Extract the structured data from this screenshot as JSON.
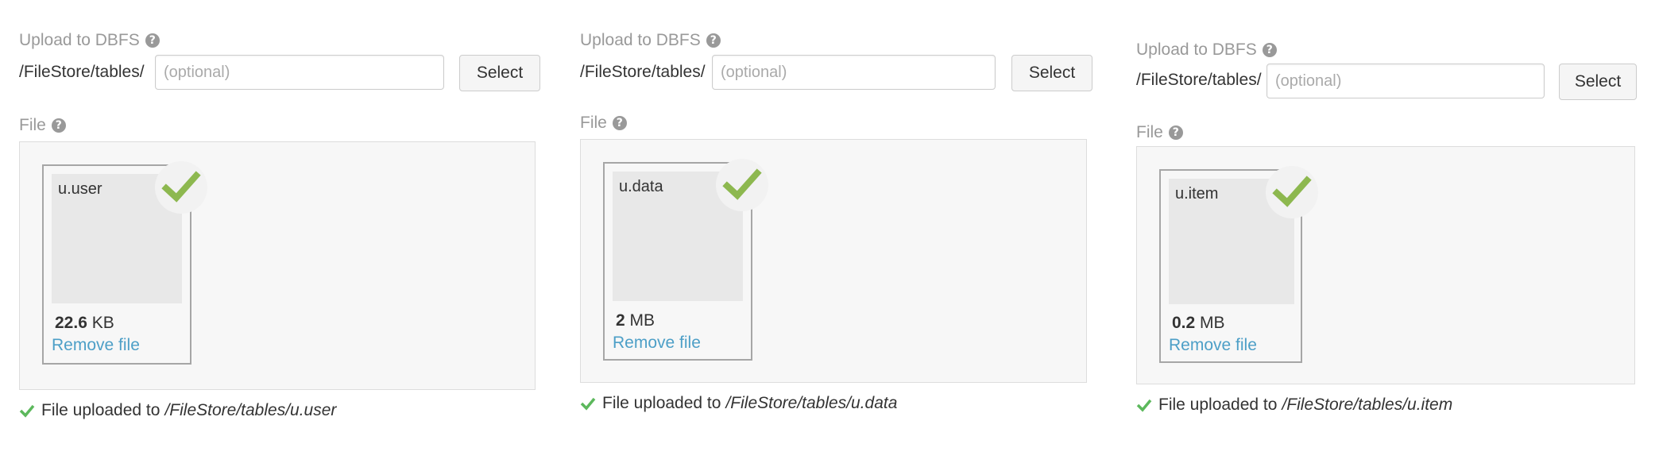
{
  "upload_label": "Upload to DBFS",
  "path_prefix": "/FileStore/tables/",
  "input_placeholder": "(optional)",
  "select_label": "Select",
  "file_label": "File",
  "remove_label": "Remove file",
  "status_text": "File uploaded to",
  "help_icon": "question-circle-icon",
  "check_icon": "checkmark-icon",
  "colors": {
    "check_green": "#8db84f",
    "link_blue": "#4d9fc7",
    "status_green": "#5cb85c"
  },
  "panels": [
    {
      "file_name": "u.user",
      "size_value": "22.6",
      "size_unit": "KB",
      "uploaded_path": "/FileStore/tables/u.user"
    },
    {
      "file_name": "u.data",
      "size_value": "2",
      "size_unit": "MB",
      "uploaded_path": "/FileStore/tables/u.data"
    },
    {
      "file_name": "u.item",
      "size_value": "0.2",
      "size_unit": "MB",
      "uploaded_path": "/FileStore/tables/u.item"
    }
  ]
}
